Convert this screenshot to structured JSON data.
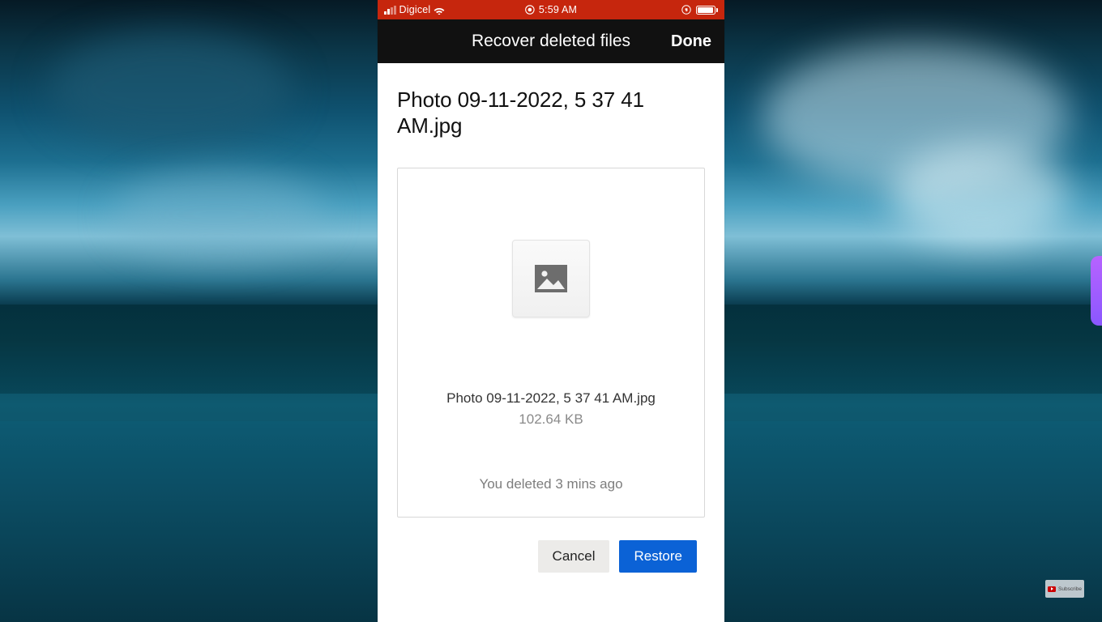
{
  "statusbar": {
    "carrier": "Digicel",
    "time": "5:59 AM"
  },
  "navbar": {
    "title": "Recover deleted files",
    "done_label": "Done"
  },
  "file": {
    "title": "Photo 09-11-2022, 5 37 41 AM.jpg",
    "caption_name": "Photo 09-11-2022, 5 37 41 AM.jpg",
    "size": "102.64 KB",
    "deleted_text": "You deleted 3 mins ago",
    "thumbnail_icon": "image-placeholder-icon"
  },
  "actions": {
    "cancel_label": "Cancel",
    "restore_label": "Restore"
  },
  "overlay": {
    "subscribe_label": "Subscribe"
  }
}
